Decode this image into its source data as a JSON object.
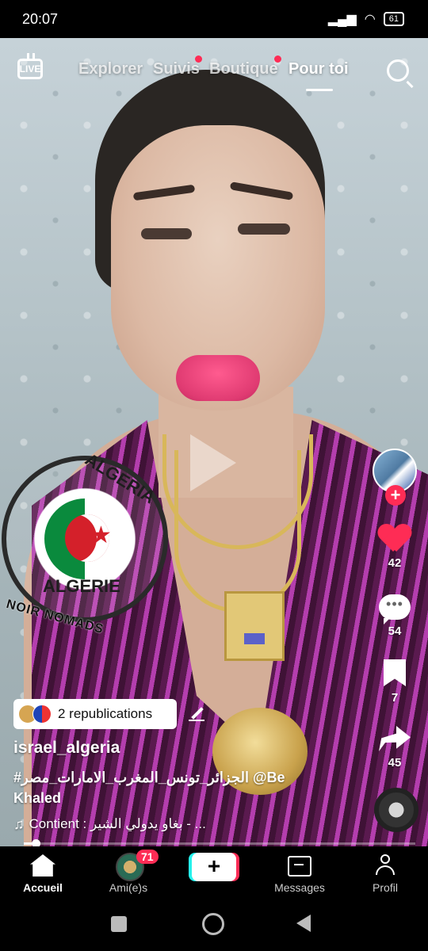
{
  "status_bar": {
    "time": "20:07",
    "battery": "61"
  },
  "top_nav": {
    "live_label": "LIVE",
    "tabs": [
      {
        "label": "Explorer",
        "has_dot": false
      },
      {
        "label": "Suivis",
        "has_dot": true
      },
      {
        "label": "Boutique",
        "has_dot": true
      },
      {
        "label": "Pour toi",
        "active": true
      }
    ],
    "search_icon": "search-icon"
  },
  "video": {
    "emblem_top_text": "ALGERIA",
    "emblem_bottom_text": "ALGERIE",
    "watermark": "NOIR NOMADS",
    "play_icon": "play-icon"
  },
  "actions": {
    "likes": "42",
    "comments": "54",
    "saves": "7",
    "shares": "45"
  },
  "post": {
    "republications": "2 republications",
    "username": "israel_algeria",
    "caption_line1": "#الجزائر_تونس_المغرب_الامارات_مصر @Be",
    "caption_line2": "Khaled",
    "music": "Contient : بغاو يدولي الشير - ..."
  },
  "progress": {
    "fraction": 0.03
  },
  "bottom_nav": {
    "home": "Accueil",
    "friends": "Ami(e)s",
    "friends_badge": "71",
    "create": "+",
    "messages": "Messages",
    "profile": "Profil"
  },
  "colors": {
    "accent": "#fe2c55",
    "cyan": "#25f4ee"
  }
}
